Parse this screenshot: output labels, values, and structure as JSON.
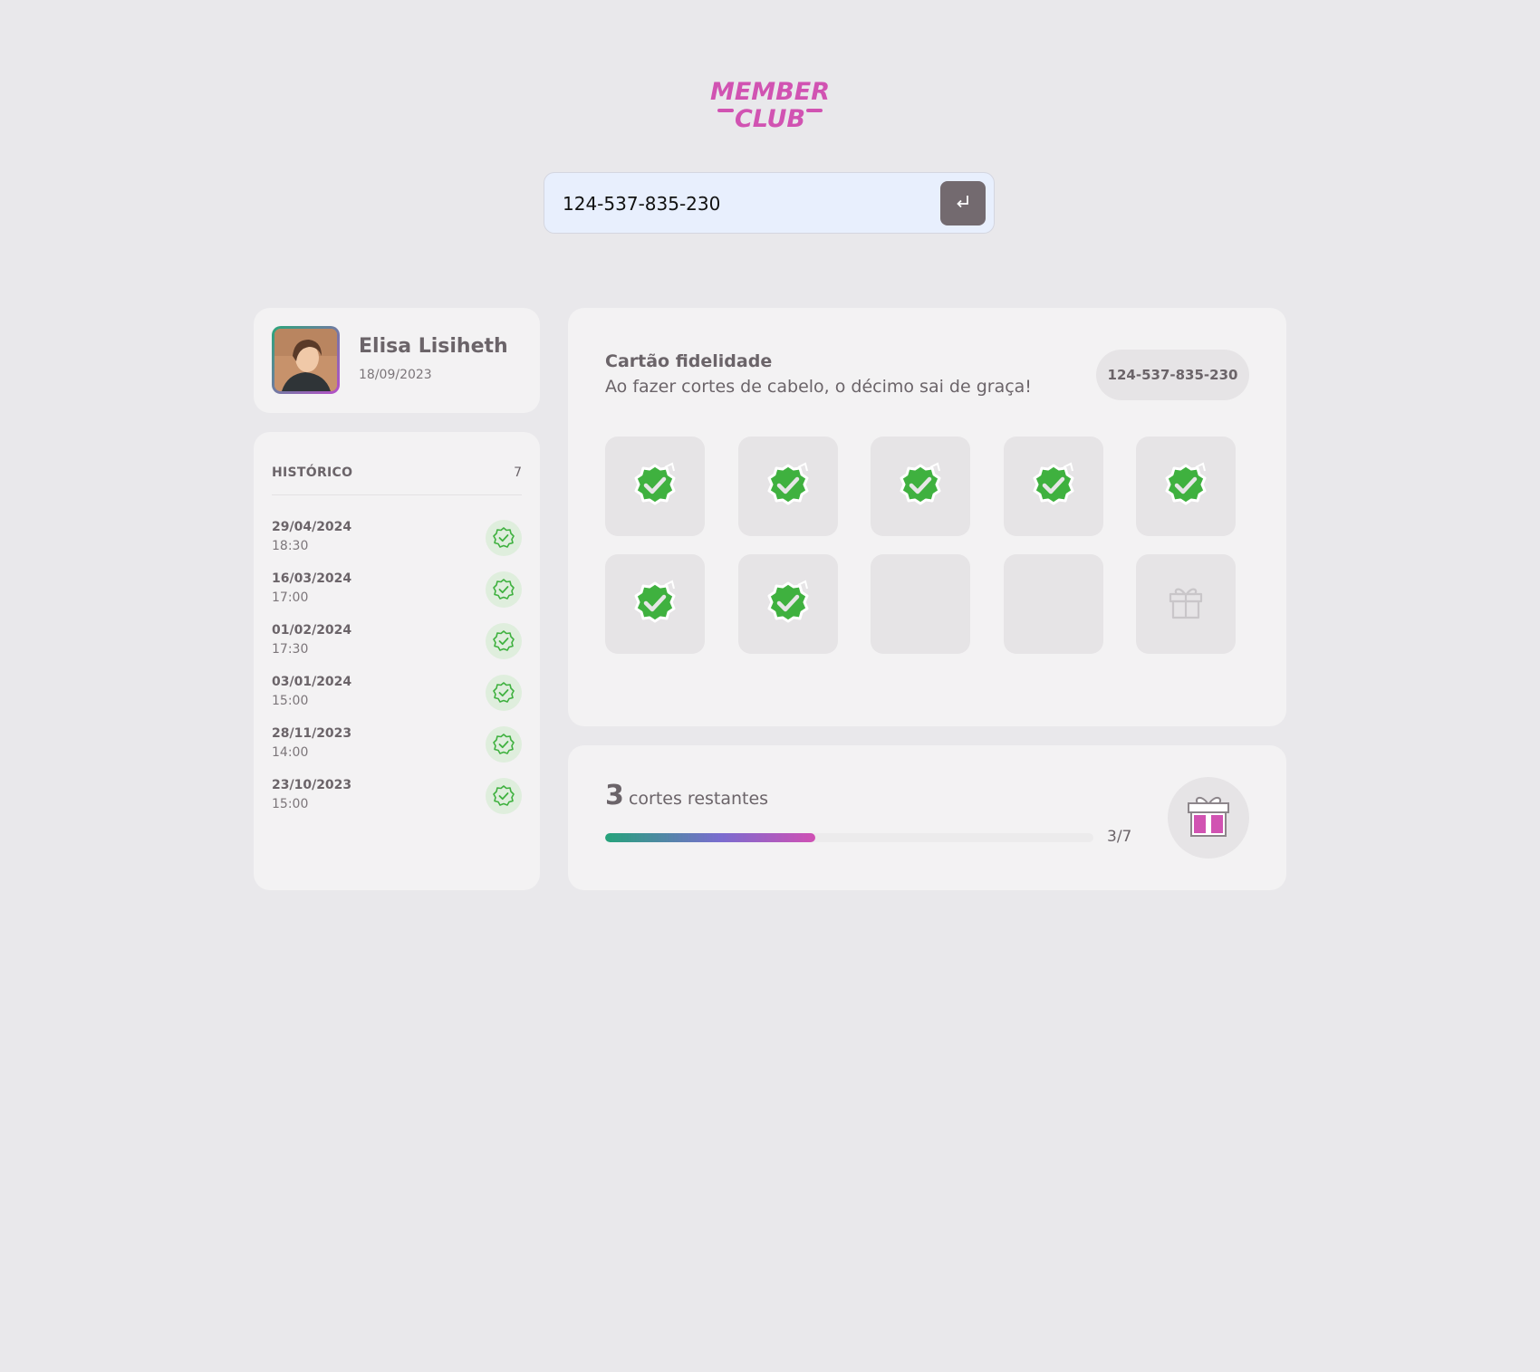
{
  "logo": {
    "line1": "MEMBER",
    "line2": "CLUB",
    "color": "#d153b2"
  },
  "search": {
    "value": "124-537-835-230",
    "placeholder": "",
    "submit_icon": "enter-icon"
  },
  "profile": {
    "name": "Elisa Lisiheth",
    "member_since": "18/09/2023"
  },
  "history": {
    "title": "HISTÓRICO",
    "count": "7",
    "items": [
      {
        "date": "29/04/2024",
        "time": "18:30"
      },
      {
        "date": "16/03/2024",
        "time": "17:00"
      },
      {
        "date": "01/02/2024",
        "time": "17:30"
      },
      {
        "date": "03/01/2024",
        "time": "15:00"
      },
      {
        "date": "28/11/2023",
        "time": "14:00"
      },
      {
        "date": "23/10/2023",
        "time": "15:00"
      }
    ]
  },
  "loyalty": {
    "title": "Cartão fidelidade",
    "subtitle": "Ao fazer cortes de cabelo, o décimo sai de graça!",
    "card_id": "124-537-835-230",
    "stamps": [
      "checked",
      "checked",
      "checked",
      "checked",
      "checked",
      "checked",
      "checked",
      "empty",
      "empty",
      "gift"
    ]
  },
  "progress": {
    "remaining": "3",
    "remaining_label": "cortes restantes",
    "ratio": "3/7",
    "fill_fraction": 0.43,
    "reward_icon": "gift-icon"
  },
  "colors": {
    "accent_green": "#3fb13f",
    "accent_pink": "#d153b2",
    "background": "#e9e8eb",
    "card": "#f3f2f3"
  }
}
